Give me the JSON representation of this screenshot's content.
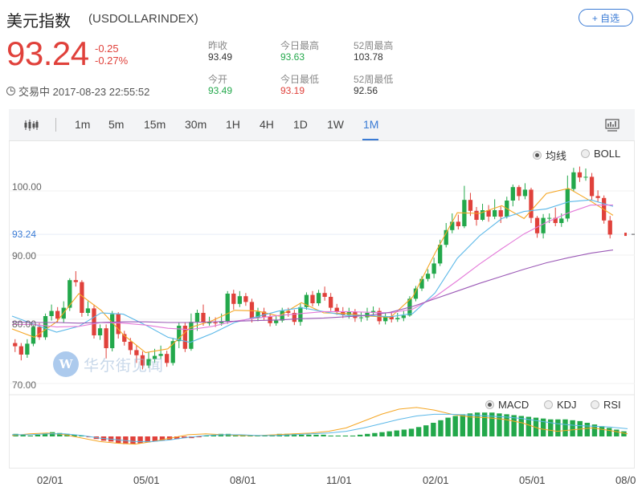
{
  "header": {
    "name": "美元指数",
    "code": "(USDOLLARINDEX)",
    "add_button": "+ 自选"
  },
  "quote": {
    "price": "93.24",
    "change": "-0.25",
    "change_pct": "-0.27%",
    "status": "交易中 2017-08-23 22:55:52"
  },
  "stats": {
    "prev_close_label": "昨收",
    "prev_close": "93.49",
    "open_label": "今开",
    "open": "93.49",
    "high_label": "今日最高",
    "high": "93.63",
    "low_label": "今日最低",
    "low": "93.19",
    "w52_high_label": "52周最高",
    "w52_high": "103.78",
    "w52_low_label": "52周最低",
    "w52_low": "92.56"
  },
  "toolbar": {
    "periods": [
      "1m",
      "5m",
      "15m",
      "30m",
      "1H",
      "4H",
      "1D",
      "1W",
      "1M"
    ],
    "active": "1M"
  },
  "main_toggles": {
    "ma": "均线",
    "boll": "BOLL",
    "selected": "均线"
  },
  "sub_toggles": {
    "macd": "MACD",
    "kdj": "KDJ",
    "rsi": "RSI",
    "selected": "MACD"
  },
  "watermark": "华尔街见闻",
  "colors": {
    "up": "#e0413b",
    "down": "#23a84b",
    "accent": "#3a7bd5",
    "ma5": "#f5a623",
    "ma10": "#5bb8e8",
    "ma20": "#e47ad9",
    "ma60": "#9b59b6"
  },
  "chart_data": {
    "type": "candlestick",
    "y_ticks": [
      "100.00",
      "90.00",
      "80.00",
      "70.00"
    ],
    "current_price_label": "93.24",
    "x_ticks": [
      "02/01",
      "05/01",
      "08/01",
      "11/01",
      "02/01",
      "05/01",
      "08/0"
    ],
    "ylim": [
      68.5,
      106.5
    ],
    "candles": [
      [
        76.3,
        75.8,
        76.9,
        74.9
      ],
      [
        75.8,
        74.5,
        76.3,
        73.6
      ],
      [
        74.5,
        76.2,
        76.9,
        74.0
      ],
      [
        76.2,
        78.8,
        79.1,
        75.8
      ],
      [
        78.8,
        77.2,
        79.4,
        76.8
      ],
      [
        77.2,
        80.5,
        80.9,
        76.8
      ],
      [
        80.5,
        81.3,
        82.3,
        79.8
      ],
      [
        81.3,
        80.1,
        81.9,
        79.5
      ],
      [
        80.1,
        81.8,
        82.8,
        79.5
      ],
      [
        81.8,
        86.1,
        86.4,
        81.3
      ],
      [
        86.1,
        85.8,
        87.5,
        85.1
      ],
      [
        85.8,
        81.0,
        86.1,
        80.4
      ],
      [
        81.0,
        81.7,
        82.8,
        80.5
      ],
      [
        81.7,
        77.5,
        82.3,
        77.0
      ],
      [
        77.5,
        78.6,
        79.2,
        76.8
      ],
      [
        78.6,
        75.5,
        79.2,
        73.9
      ],
      [
        75.5,
        80.8,
        81.3,
        75.0
      ],
      [
        80.8,
        77.7,
        81.1,
        77.0
      ],
      [
        77.7,
        76.5,
        78.2,
        75.9
      ],
      [
        76.5,
        75.2,
        77.1,
        74.5
      ],
      [
        75.2,
        74.4,
        76.0,
        73.2
      ],
      [
        74.4,
        72.8,
        75.0,
        72.2
      ],
      [
        72.8,
        73.8,
        74.9,
        72.4
      ],
      [
        73.8,
        74.3,
        75.4,
        73.2
      ],
      [
        74.3,
        74.6,
        75.9,
        73.8
      ],
      [
        74.6,
        73.2,
        75.1,
        72.6
      ],
      [
        73.2,
        76.6,
        77.1,
        72.8
      ],
      [
        76.6,
        79.0,
        79.5,
        75.5
      ],
      [
        79.0,
        75.4,
        79.5,
        74.9
      ],
      [
        75.4,
        79.6,
        80.9,
        75.1
      ],
      [
        79.6,
        81.0,
        81.5,
        78.2
      ],
      [
        81.0,
        79.5,
        82.3,
        79.0
      ],
      [
        79.5,
        79.5,
        80.4,
        79.0
      ],
      [
        79.5,
        79.4,
        80.3,
        78.8
      ],
      [
        79.4,
        79.7,
        80.9,
        79.0
      ],
      [
        79.7,
        84.0,
        84.4,
        79.3
      ],
      [
        84.0,
        82.4,
        84.6,
        81.5
      ],
      [
        82.4,
        83.6,
        84.4,
        81.9
      ],
      [
        83.6,
        82.7,
        84.1,
        82.1
      ],
      [
        82.7,
        80.2,
        83.2,
        79.5
      ],
      [
        80.2,
        81.2,
        81.8,
        79.7
      ],
      [
        81.2,
        80.4,
        81.8,
        79.9
      ],
      [
        80.4,
        79.4,
        80.9,
        78.9
      ],
      [
        79.4,
        79.8,
        80.5,
        79.0
      ],
      [
        79.8,
        81.3,
        81.8,
        79.5
      ],
      [
        81.3,
        81.0,
        81.8,
        80.4
      ],
      [
        81.0,
        79.6,
        81.5,
        79.1
      ],
      [
        79.6,
        81.9,
        82.5,
        79.0
      ],
      [
        81.9,
        83.8,
        84.2,
        81.5
      ],
      [
        83.8,
        82.5,
        84.4,
        82.0
      ],
      [
        82.5,
        84.1,
        84.6,
        82.1
      ],
      [
        84.1,
        83.5,
        85.1,
        82.9
      ],
      [
        83.5,
        81.8,
        84.1,
        81.3
      ],
      [
        81.8,
        81.2,
        82.4,
        80.7
      ],
      [
        81.2,
        80.7,
        81.9,
        80.2
      ],
      [
        80.7,
        81.2,
        81.8,
        80.1
      ],
      [
        81.2,
        80.2,
        81.6,
        79.6
      ],
      [
        80.2,
        80.3,
        81.1,
        79.6
      ],
      [
        80.3,
        81.0,
        81.8,
        79.8
      ],
      [
        81.0,
        81.3,
        82.0,
        80.5
      ],
      [
        81.3,
        79.7,
        81.8,
        79.2
      ],
      [
        79.7,
        80.5,
        81.0,
        79.2
      ],
      [
        80.5,
        80.0,
        81.2,
        79.5
      ],
      [
        80.0,
        80.2,
        81.0,
        79.6
      ],
      [
        80.2,
        80.6,
        81.3,
        79.7
      ],
      [
        80.6,
        83.2,
        83.6,
        80.4
      ],
      [
        83.2,
        84.8,
        85.2,
        82.8
      ],
      [
        84.8,
        86.3,
        86.7,
        84.4
      ],
      [
        86.3,
        87.1,
        87.8,
        85.9
      ],
      [
        87.1,
        88.7,
        89.6,
        86.4
      ],
      [
        88.7,
        91.6,
        92.4,
        88.3
      ],
      [
        91.6,
        93.9,
        95.0,
        91.2
      ],
      [
        93.9,
        95.2,
        96.5,
        93.4
      ],
      [
        95.2,
        94.5,
        96.3,
        94.0
      ],
      [
        94.5,
        98.6,
        100.8,
        94.2
      ],
      [
        98.6,
        96.9,
        99.7,
        96.1
      ],
      [
        96.9,
        95.5,
        97.5,
        94.6
      ],
      [
        95.5,
        97.0,
        98.0,
        95.3
      ],
      [
        97.0,
        96.0,
        97.8,
        95.2
      ],
      [
        96.0,
        97.0,
        98.7,
        95.6
      ],
      [
        97.0,
        96.0,
        97.6,
        95.0
      ],
      [
        96.0,
        98.5,
        99.1,
        95.7
      ],
      [
        98.5,
        100.6,
        101.0,
        97.6
      ],
      [
        100.6,
        99.2,
        100.9,
        98.5
      ],
      [
        99.2,
        100.2,
        101.2,
        98.7
      ],
      [
        100.2,
        95.8,
        100.5,
        95.0
      ],
      [
        95.8,
        93.4,
        96.1,
        92.7
      ],
      [
        93.4,
        95.8,
        96.4,
        92.6
      ],
      [
        95.8,
        95.8,
        96.5,
        95.0
      ],
      [
        95.8,
        95.0,
        97.4,
        94.5
      ],
      [
        95.0,
        95.7,
        96.5,
        94.4
      ],
      [
        95.7,
        100.3,
        102.4,
        95.2
      ],
      [
        100.3,
        102.9,
        103.6,
        99.9
      ],
      [
        102.9,
        102.1,
        103.8,
        101.4
      ],
      [
        102.1,
        102.2,
        103.5,
        101.6
      ],
      [
        102.2,
        99.2,
        102.8,
        98.6
      ],
      [
        99.2,
        98.9,
        100.1,
        98.3
      ],
      [
        98.9,
        95.4,
        99.3,
        94.9
      ],
      [
        95.4,
        93.2,
        96.1,
        92.6
      ]
    ],
    "ma": {
      "MA5": [
        78.5,
        77.2,
        79.6,
        84.0,
        81.4,
        77.6,
        74.8,
        75.4,
        78.7,
        79.8,
        81.4,
        81.3,
        80.5,
        82.6,
        81.0,
        80.9,
        80.5,
        80.3,
        83.5,
        90.3,
        96.6,
        96.5,
        97.7,
        95.7,
        99.6,
        100.4,
        98.4,
        96.2
      ],
      "MA10": [
        80.5,
        79.2,
        78.0,
        78.9,
        81.0,
        80.8,
        79.1,
        77.2,
        76.4,
        77.8,
        79.5,
        80.4,
        81.3,
        81.8,
        81.2,
        80.6,
        80.6,
        80.4,
        80.9,
        84.1,
        89.5,
        93.0,
        95.7,
        96.8,
        97.2,
        98.3,
        98.6,
        97.6
      ],
      "MA20": [
        79.2,
        79.2,
        78.8,
        78.9,
        79.5,
        79.4,
        79.1,
        78.6,
        78.4,
        78.9,
        79.7,
        80.2,
        80.6,
        80.9,
        81.2,
        81.2,
        81.1,
        81.0,
        81.6,
        83.5,
        86.0,
        88.6,
        91.0,
        93.3,
        95.1,
        96.6,
        97.8,
        97.8
      ],
      "MA60": [
        79.6,
        79.5,
        79.5,
        79.4,
        79.5,
        79.6,
        79.6,
        79.5,
        79.5,
        79.6,
        79.7,
        79.8,
        79.9,
        80.1,
        80.2,
        80.4,
        80.6,
        81.1,
        82.0,
        83.2,
        84.4,
        85.6,
        86.7,
        87.8,
        88.8,
        89.6,
        90.3,
        90.8
      ]
    },
    "macd_hist": [
      0.3,
      0.2,
      0.1,
      0.2,
      0.4,
      0.5,
      0.4,
      0.3,
      0.2,
      0.1,
      -0.1,
      -0.3,
      -0.5,
      -0.6,
      -0.8,
      -0.9,
      -0.9,
      -0.8,
      -0.7,
      -0.6,
      -0.5,
      -0.4,
      -0.3,
      -0.2,
      -0.2,
      -0.1,
      0.1,
      0.2,
      0.3,
      0.3,
      0.2,
      0.2,
      0.1,
      0.1,
      0.1,
      0.2,
      0.3,
      0.3,
      0.3,
      0.2,
      0.2,
      0.2,
      0.2,
      0.1,
      0.1,
      0.1,
      0.1,
      0.2,
      0.3,
      0.4,
      0.5,
      0.6,
      0.7,
      0.8,
      0.9,
      1.1,
      1.3,
      1.6,
      1.9,
      2.2,
      2.4,
      2.6,
      2.7,
      2.8,
      2.8,
      2.8,
      2.7,
      2.6,
      2.5,
      2.4,
      2.3,
      2.2,
      2.1,
      2.0,
      2.0,
      2.0,
      1.9,
      1.8,
      1.6,
      1.4,
      1.2,
      1.0,
      0.8,
      0.6
    ],
    "macd_dif": [
      0.1,
      0.3,
      0.4,
      0.2,
      -0.2,
      -0.6,
      -0.8,
      -0.9,
      -0.6,
      -0.2,
      0.2,
      0.3,
      0.2,
      0.1,
      0.1,
      0.2,
      0.3,
      0.4,
      0.6,
      1.0,
      1.8,
      2.6,
      3.2,
      3.4,
      3.1,
      2.6,
      2.3,
      2.2,
      2.0,
      1.6,
      0.9,
      0.6,
      0.8,
      1.0,
      0.7,
      0.3
    ],
    "macd_dea": [
      0.2,
      0.2,
      0.3,
      0.3,
      0.1,
      -0.2,
      -0.4,
      -0.6,
      -0.6,
      -0.4,
      -0.1,
      0.1,
      0.2,
      0.2,
      0.1,
      0.1,
      0.2,
      0.3,
      0.4,
      0.6,
      1.0,
      1.5,
      2.0,
      2.4,
      2.6,
      2.6,
      2.5,
      2.4,
      2.3,
      2.1,
      1.8,
      1.5,
      1.3,
      1.2,
      1.1,
      0.9
    ]
  }
}
